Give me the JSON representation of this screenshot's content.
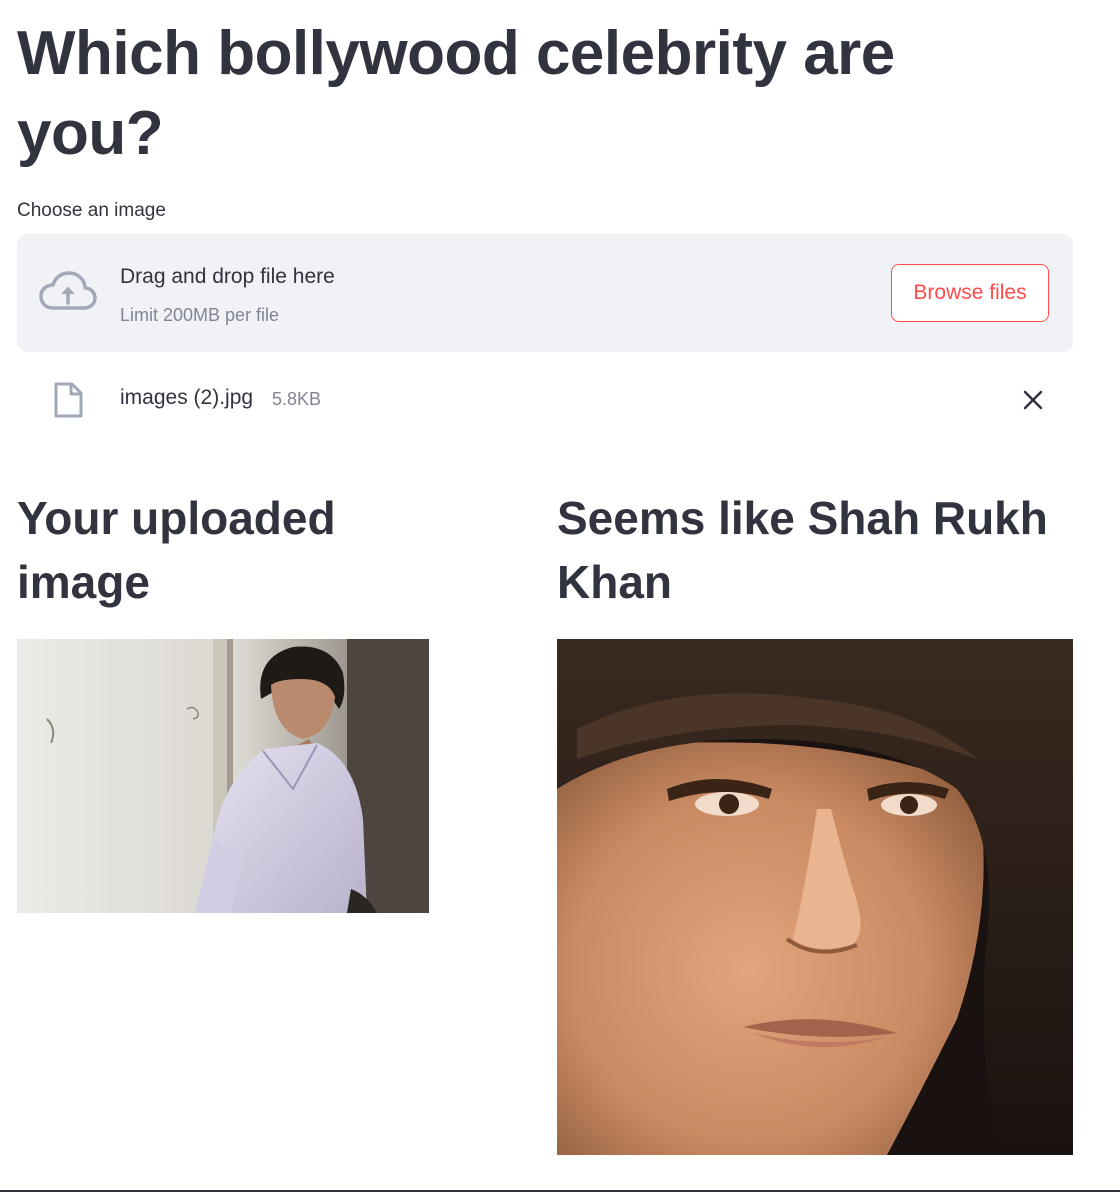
{
  "title": "Which bollywood celebrity are you?",
  "uploader": {
    "label": "Choose an image",
    "drop_text": "Drag and drop file here",
    "limit_text": "Limit 200MB per file",
    "browse_label": "Browse files",
    "accent_color": "#ff4b4b"
  },
  "uploaded_file": {
    "name": "images (2).jpg",
    "size": "5.8KB"
  },
  "columns": {
    "left_heading": "Your uploaded image",
    "right_heading": "Seems like Shah Rukh Khan"
  },
  "icons": {
    "upload": "cloud-upload-icon",
    "file": "file-icon",
    "close": "close-icon"
  }
}
